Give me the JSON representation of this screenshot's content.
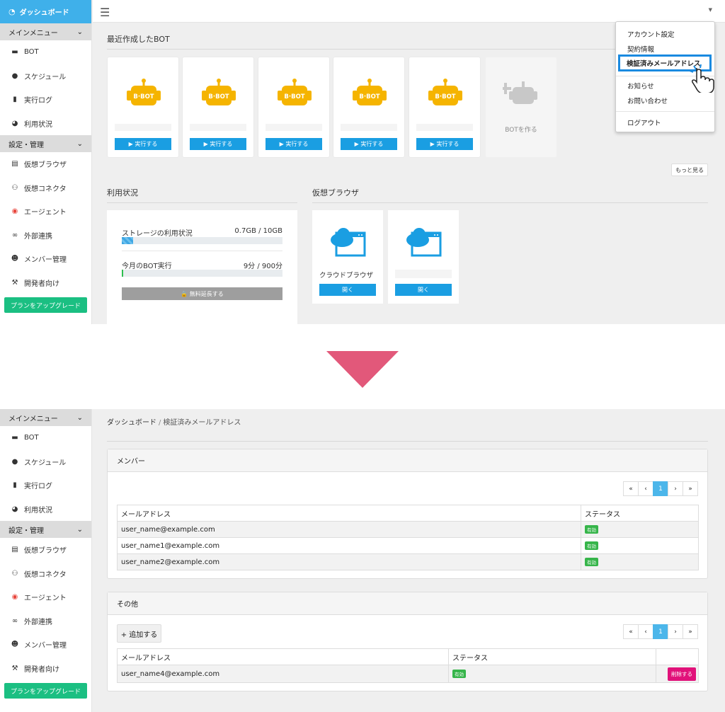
{
  "sidebar": {
    "dashboard": "ダッシュボード",
    "main_menu": "メインメニュー",
    "main_items": [
      "BOT",
      "スケジュール",
      "実行ログ",
      "利用状況"
    ],
    "settings_section": "設定・管理",
    "settings_items": [
      "仮想ブラウザ",
      "仮想コネクタ",
      "エージェント",
      "外部連携",
      "メンバー管理",
      "開発者向け"
    ],
    "upgrade": "プランをアップグレード"
  },
  "top": {
    "recent_bots_title": "最近作成したBOT",
    "bot_logo": "B·BOT",
    "run_label": "▶ 実行する",
    "create_bot": "BOTを作る",
    "more": "もっと見る",
    "usage_title": "利用状況",
    "storage_label": "ストレージの利用状況",
    "storage_value": "0.7GB / 10GB",
    "storage_fraction": 0.07,
    "runs_label": "今月のBOT実行",
    "runs_value": "9分 / 900分",
    "runs_fraction": 0.01,
    "extend": "🔒 無料延長する",
    "vbrowser_title": "仮想ブラウザ",
    "vbrowser_name": "クラウドブラウザ",
    "open": "開く"
  },
  "dropdown": {
    "items": [
      "アカウント設定",
      "契約情報",
      "検証済みメールアドレス",
      "お知らせ",
      "お問い合わせ",
      "ログアウト"
    ]
  },
  "bottom": {
    "breadcrumb_home": "ダッシュボード",
    "breadcrumb_sep": "/",
    "breadcrumb_current": "検証済みメールアドレス",
    "members_title": "メンバー",
    "others_title": "その他",
    "col_email": "メールアドレス",
    "col_status": "ステータス",
    "pager": [
      "«",
      "‹",
      "1",
      "›",
      "»"
    ],
    "members": [
      {
        "email": "user_name@example.com",
        "status": "有効"
      },
      {
        "email": "user_name1@example.com",
        "status": "有効"
      },
      {
        "email": "user_name2@example.com",
        "status": "有効"
      }
    ],
    "add": "+ 追加する",
    "others": [
      {
        "email": "user_name4@example.com",
        "status": "有効",
        "action": "削除する"
      }
    ]
  },
  "colors": {
    "accent": "#1a9ee2",
    "sidebar_head": "#3fb0ea",
    "upgrade": "#1bbf82",
    "bot_yellow": "#f5b400",
    "delete": "#e1127a",
    "arrow": "#e2587a",
    "ok": "#36b54a"
  }
}
